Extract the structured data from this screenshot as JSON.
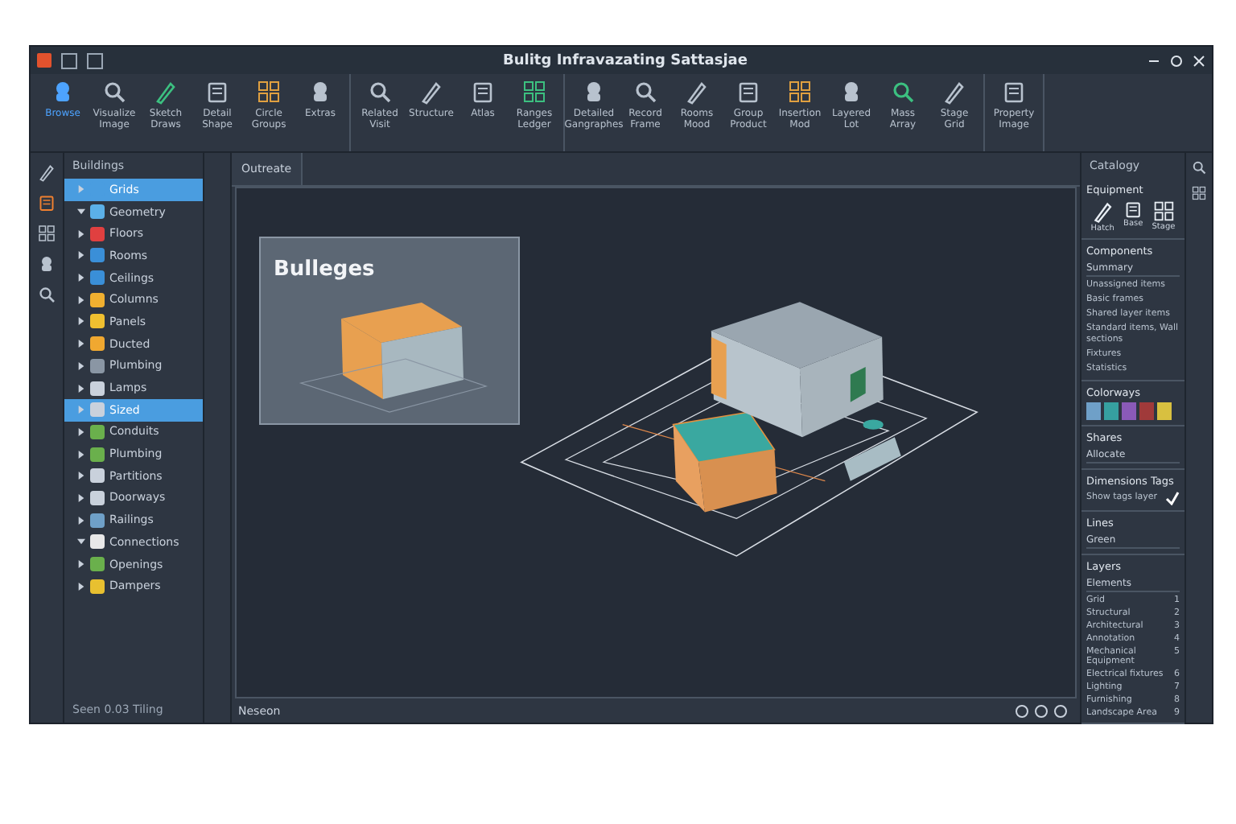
{
  "window": {
    "title": "Bulitg Infravazating Sattasjae"
  },
  "ribbon": {
    "groups": [
      {
        "tools": [
          {
            "label": "Browse",
            "selected": true
          },
          {
            "label": "Visualize Image",
            "selected": false
          },
          {
            "label": "Sketch Draws",
            "selected": false
          },
          {
            "label": "Detail Shape",
            "selected": false
          },
          {
            "label": "Circle Groups",
            "selected": false
          },
          {
            "label": "Extras",
            "selected": false
          }
        ]
      },
      {
        "tools": [
          {
            "label": "Related Visit",
            "selected": false
          },
          {
            "label": "Structure",
            "selected": false
          },
          {
            "label": "Atlas",
            "selected": false
          },
          {
            "label": "Ranges Ledger",
            "selected": false
          }
        ]
      },
      {
        "tools": [
          {
            "label": "Detailed Gangraphes",
            "selected": false
          },
          {
            "label": "Record Frame",
            "selected": false
          },
          {
            "label": "Rooms Mood",
            "selected": false
          },
          {
            "label": "Group Product",
            "selected": false
          },
          {
            "label": "Insertion Mod",
            "selected": false
          },
          {
            "label": "Layered Lot",
            "selected": false
          },
          {
            "label": "Mass Array",
            "selected": false
          },
          {
            "label": "Stage Grid",
            "selected": false
          }
        ]
      },
      {
        "tools": [
          {
            "label": "Property Image",
            "selected": false
          }
        ]
      }
    ]
  },
  "tree": {
    "title": "Buildings",
    "items": [
      {
        "label": "Grids",
        "selected": true,
        "expanded": false
      },
      {
        "label": "Geometry",
        "selected": false,
        "expanded": true
      },
      {
        "label": "Floors",
        "selected": false,
        "expanded": false
      },
      {
        "label": "Rooms",
        "selected": false,
        "expanded": false
      },
      {
        "label": "Ceilings",
        "selected": false,
        "expanded": false
      },
      {
        "label": "Columns",
        "selected": false,
        "expanded": false
      },
      {
        "label": "Panels",
        "selected": false,
        "expanded": false
      },
      {
        "label": "Ducted",
        "selected": false,
        "expanded": false
      },
      {
        "label": "Plumbing",
        "selected": false,
        "expanded": false
      },
      {
        "label": "Lamps",
        "selected": false,
        "expanded": false
      },
      {
        "label": "Sized",
        "selected": true,
        "expanded": false
      },
      {
        "label": "Conduits",
        "selected": false,
        "expanded": false
      },
      {
        "label": "Plumbing",
        "selected": false,
        "expanded": false
      },
      {
        "label": "Partitions",
        "selected": false,
        "expanded": false
      },
      {
        "label": "Doorways",
        "selected": false,
        "expanded": false
      },
      {
        "label": "Railings",
        "selected": false,
        "expanded": false
      },
      {
        "label": "Connections",
        "selected": false,
        "expanded": true
      },
      {
        "label": "Openings",
        "selected": false,
        "expanded": false
      },
      {
        "label": "Dampers",
        "selected": false,
        "expanded": false
      }
    ],
    "status": "Seen 0.03 Tiling"
  },
  "viewport": {
    "tab": "Outreate",
    "inset_title": "Bulleges",
    "bottom_tab": "Neseon"
  },
  "properties": {
    "title": "Catalogy",
    "sections": [
      {
        "kind": "icons",
        "title": "Equipment",
        "items": [
          "Hatch",
          "Base",
          "Stage"
        ]
      },
      {
        "kind": "list",
        "title": "Components",
        "field": "Summary",
        "items": [
          "Unassigned items",
          "Basic frames",
          "Shared layer items",
          "Standard items, Wall sections",
          "Fixtures",
          "Statistics"
        ]
      },
      {
        "kind": "swatches",
        "title": "Colorways"
      },
      {
        "kind": "field",
        "title": "Shares",
        "field": "Allocate"
      },
      {
        "kind": "check",
        "title": "Dimensions Tags",
        "field": "Show tags layer"
      },
      {
        "kind": "field",
        "title": "Lines",
        "field": "Green"
      },
      {
        "kind": "layers",
        "title": "Layers",
        "field": "Elements",
        "items": [
          [
            "Grid",
            "1"
          ],
          [
            "Structural",
            "2"
          ],
          [
            "Architectural",
            "3"
          ],
          [
            "Annotation",
            "4"
          ],
          [
            "Mechanical Equipment",
            "5"
          ],
          [
            "Electrical fixtures",
            "6"
          ],
          [
            "Lighting",
            "7"
          ],
          [
            "Furnishing",
            "8"
          ],
          [
            "Landscape Area",
            "9"
          ]
        ]
      }
    ]
  }
}
